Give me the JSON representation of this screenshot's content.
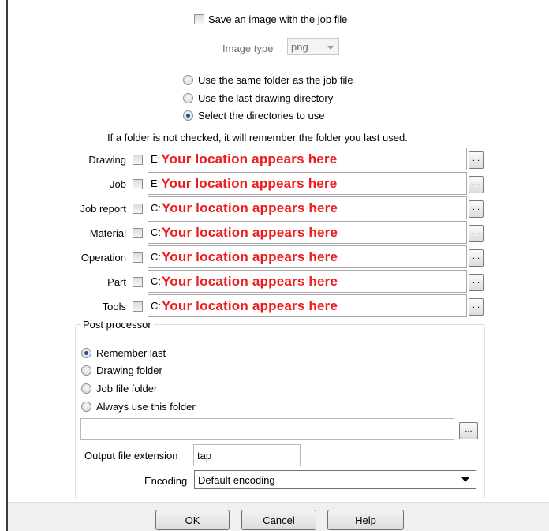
{
  "save_image": {
    "label": "Save an image with the job file",
    "checked": false
  },
  "image_type": {
    "label": "Image type",
    "value": "png"
  },
  "folder_options": [
    {
      "label": "Use the same folder as the job file",
      "checked": false
    },
    {
      "label": "Use the last drawing directory",
      "checked": false
    },
    {
      "label": "Select the directories to use",
      "checked": true
    }
  ],
  "folder_hint": "If a folder is not checked, it will remember the folder you last used.",
  "directories": [
    {
      "label": "Drawing",
      "drive": "E:",
      "path": "Your location appears here",
      "checked": false
    },
    {
      "label": "Job",
      "drive": "E:",
      "path": "Your location appears here",
      "checked": false
    },
    {
      "label": "Job report",
      "drive": "C:",
      "path": "Your location appears here",
      "checked": false
    },
    {
      "label": "Material",
      "drive": "C:",
      "path": "Your location appears here",
      "checked": false
    },
    {
      "label": "Operation",
      "drive": "C:",
      "path": "Your location appears here",
      "checked": false
    },
    {
      "label": "Part",
      "drive": "C:",
      "path": "Your location appears here",
      "checked": false
    },
    {
      "label": "Tools",
      "drive": "C:",
      "path": "Your location appears here",
      "checked": false
    }
  ],
  "browse_label": "...",
  "post_processor": {
    "title": "Post processor",
    "options": [
      {
        "label": "Remember last",
        "checked": true
      },
      {
        "label": "Drawing folder",
        "checked": false
      },
      {
        "label": "Job file folder",
        "checked": false
      },
      {
        "label": "Always use this folder",
        "checked": false
      }
    ],
    "folder_value": "",
    "output_ext_label": "Output file extension",
    "output_ext_value": "tap",
    "encoding_label": "Encoding",
    "encoding_value": "Default encoding"
  },
  "buttons": {
    "ok": "OK",
    "cancel": "Cancel",
    "help": "Help"
  },
  "colors": {
    "location_text": "#ee1c1c",
    "radio_selected": "#1d4ea0"
  },
  "icons": {
    "dropdown": "chevron-down-icon",
    "browse": "ellipsis-icon"
  }
}
